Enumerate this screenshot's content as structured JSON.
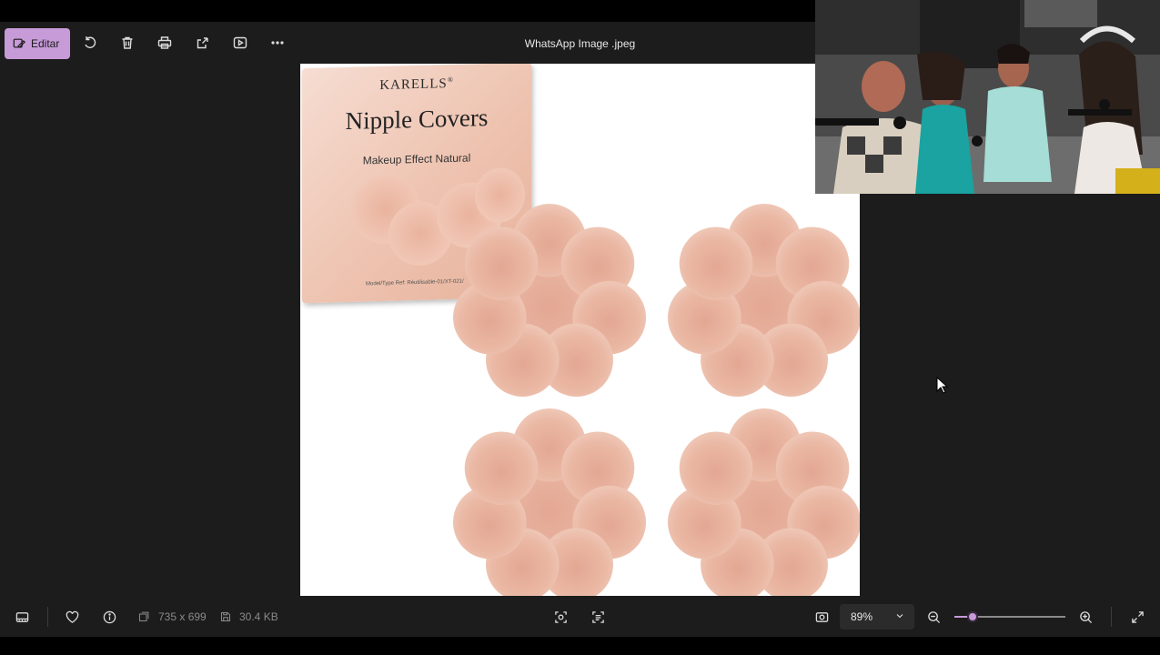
{
  "toolbar": {
    "edit_label": "Editar",
    "title": "WhatsApp Image .jpeg"
  },
  "product": {
    "brand": "KARELLS",
    "brand_mark": "®",
    "title": "Nipple Covers",
    "subtitle": "Makeup Effect Natural",
    "model_text": "Model/Type Ref: Réutilisable-01/XT-021/"
  },
  "status": {
    "dimensions": "735 x 699",
    "file_size": "30.4 KB",
    "zoom": "89%",
    "zoom_fraction": 0.16
  },
  "colors": {
    "accent": "#c79ad8",
    "chrome": "#1c1c1c",
    "petal": "#eab8a4"
  }
}
